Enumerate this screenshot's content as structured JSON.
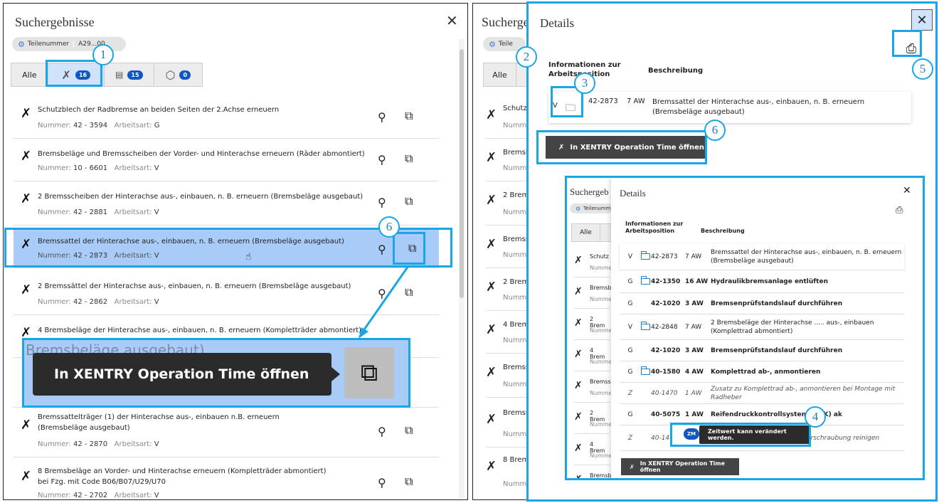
{
  "left": {
    "title": "Suchergebnisse",
    "chip": {
      "label": "Teilenummer",
      "value": "A29...00"
    },
    "tabs": [
      {
        "label": "Alle"
      },
      {
        "icon": "wrench-cross-icon",
        "count": "16"
      },
      {
        "icon": "wis-document-icon",
        "count": "15"
      },
      {
        "icon": "box-icon",
        "count": "0"
      }
    ],
    "number_label": "Nummer:",
    "type_label": "Arbeitsart:",
    "results": [
      {
        "title": "Schutzblech der Radbremse an beiden Seiten der 2.Achse erneuern",
        "number": "42 - 3594",
        "type": "G"
      },
      {
        "title": "Bremsbeläge und Bremsscheiben der Vorder- und Hinterachse erneuern (Räder abmontiert)",
        "number": "10 - 6601",
        "type": "V"
      },
      {
        "title": "2 Bremsscheiben der Hinterachse aus-, einbauen, n. B. erneuern (Bremsbeläge ausgebaut)",
        "number": "42 - 2881",
        "type": "V"
      },
      {
        "title": "Bremssattel der Hinterachse aus-, einbauen, n. B. erneuern (Bremsbeläge ausgebaut)",
        "number": "42 - 2873",
        "type": "V"
      },
      {
        "title": "2 Bremssättel der Hinterachse aus-, einbauen, n. B. erneuern (Bremsbeläge ausgebaut)",
        "number": "42 - 2862",
        "type": "V"
      },
      {
        "title": "4 Bremsbeläge der Hinterachse aus-, einbauen, n. B. erneuern (Kompletträder abmontiert)",
        "number": "",
        "type": ""
      },
      {
        "title": "Bremssattelträger (1) der Hinterachse aus-, einbauen n.B. erneuern (Bremsbeläge ausgebaut)",
        "number": "42 - 2870",
        "type": "V"
      },
      {
        "title": "8 Bremsbeläge an Vorder- und Hinterachse erneuern (Kompletträder abmontiert) bei Fzg. mit Code B06/B07/U29/U70",
        "number": "42 - 2702",
        "type": "V"
      }
    ],
    "zoom_caption": "Bremsbeläge ausgebaut)",
    "zoom_tooltip": "In XENTRY Operation Time öffnen"
  },
  "right": {
    "bg_title": "Suchergeb",
    "bg_chip": "Teile",
    "bg_tab": "Alle",
    "bg_rows": [
      "Schutz",
      "Bremsb",
      "2 Brem",
      "Bremss",
      "2 Brem",
      "4 Brem",
      "Bremss",
      "2 Brem",
      "Bremss",
      "8 Brem"
    ],
    "bg_rows_meta": "Numm",
    "details": {
      "title": "Details",
      "col1": "Informationen zur Arbeitsposition",
      "col2": "Beschreibung",
      "row": {
        "type": "V",
        "number": "42-2873",
        "aw": "7 AW",
        "desc": "Bremssattel der Hinterachse aus-, einbauen, n. B. erneuern (Bremsbeläge ausgebaut)"
      },
      "button": "In XENTRY Operation Time öffnen"
    },
    "inner": {
      "bg_title": "Suchergeb",
      "bg_chip": "Teilenumm",
      "bg_tab": "Alle",
      "bg_rows": [
        "Schutz",
        "Bremsb",
        "2 Brem",
        "4 Brem",
        "Bremss",
        "2 Brem",
        "4 Brem",
        "Bremsb"
      ],
      "bg_meta": "Numme",
      "title": "Details",
      "col1": "Informationen zur Arbeitsposition",
      "col2": "Beschreibung",
      "rows": [
        {
          "type": "V",
          "number": "42-2873",
          "aw": "7 AW",
          "desc": "Bremssattel der Hinterachse aus-, einbauen, n. B. erneuern (Bremsbeläge ausgebaut)",
          "folder": true,
          "bold": false,
          "italic": false
        },
        {
          "type": "G",
          "number": "42-1350",
          "aw": "16 AW",
          "desc": "Hydraulikbremsanlage entlüften",
          "folder": true,
          "bold": true,
          "italic": false
        },
        {
          "type": "G",
          "number": "42-1020",
          "aw": "3 AW",
          "desc": "Bremsenprüfstandslauf durchführen",
          "folder": false,
          "bold": true,
          "italic": false
        },
        {
          "type": "V",
          "number": "42-2848",
          "aw": "7 AW",
          "desc": "2 Bremsbeläge der Hinterachse ..... aus-, einbauen (Komplettrad abmontiert)",
          "folder": true,
          "bold": false,
          "italic": false
        },
        {
          "type": "G",
          "number": "42-1020",
          "aw": "3 AW",
          "desc": "Bremsenprüfstandslauf durchführen",
          "folder": false,
          "bold": true,
          "italic": false
        },
        {
          "type": "G",
          "number": "40-1580",
          "aw": "4 AW",
          "desc": "Komplettrad ab-, anmontieren",
          "folder": true,
          "bold": true,
          "italic": false
        },
        {
          "type": "Z",
          "number": "40-1470",
          "aw": "1 AW",
          "desc": "Zusatz zu Komplettrad ab-, anmontieren bei Montage mit Radheber",
          "folder": false,
          "bold": false,
          "italic": true
        },
        {
          "type": "G",
          "number": "40-5075",
          "aw": "1 AW",
          "desc": "Reifendruckkontrollsystem (RDK) ak",
          "folder": false,
          "bold": true,
          "italic": false
        },
        {
          "type": "Z",
          "number": "40-14",
          "aw": "",
          "desc": "ieren, Komponenten der Radverschraubung reinigen",
          "folder": false,
          "bold": false,
          "italic": true
        }
      ],
      "zm_badge": "ZM",
      "tooltip": "Zeitwert kann verändert werden.",
      "button": "In XENTRY Operation Time öffnen"
    }
  },
  "callouts": [
    "1",
    "2",
    "3",
    "4",
    "5",
    "6"
  ]
}
